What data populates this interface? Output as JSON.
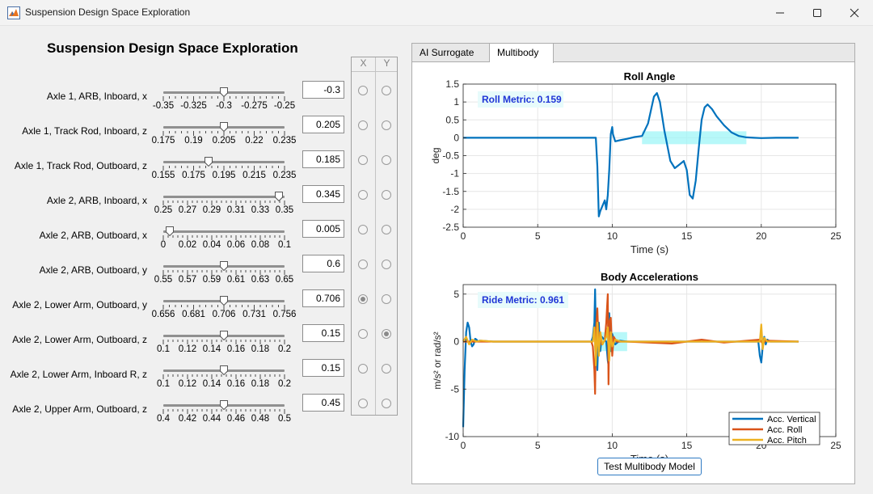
{
  "window": {
    "title": "Suspension Design Space Exploration"
  },
  "main_title": "Suspension Design Space Exploration",
  "axis_headers": {
    "x": "X",
    "y": "Y"
  },
  "parameters": [
    {
      "label": "Axle 1, ARB, Inboard, x",
      "value": "-0.3",
      "min": -0.35,
      "max": -0.25,
      "position": -0.3,
      "ticks": [
        "-0.35",
        "-0.325",
        "-0.3",
        "-0.275",
        "-0.25"
      ],
      "x_selected": false,
      "y_selected": false
    },
    {
      "label": "Axle 1, Track Rod, Inboard, z",
      "value": "0.205",
      "min": 0.175,
      "max": 0.235,
      "position": 0.205,
      "ticks": [
        "0.175",
        "0.19",
        "0.205",
        "0.22",
        "0.235"
      ],
      "x_selected": false,
      "y_selected": false
    },
    {
      "label": "Axle 1, Track Rod, Outboard, z",
      "value": "0.185",
      "min": 0.155,
      "max": 0.235,
      "position": 0.185,
      "ticks": [
        "0.155",
        "0.175",
        "0.195",
        "0.215",
        "0.235"
      ],
      "x_selected": false,
      "y_selected": false
    },
    {
      "label": "Axle 2, ARB, Inboard, x",
      "value": "0.345",
      "min": 0.25,
      "max": 0.35,
      "position": 0.345,
      "ticks": [
        "0.25",
        "0.27",
        "0.29",
        "0.31",
        "0.33",
        "0.35"
      ],
      "x_selected": false,
      "y_selected": false
    },
    {
      "label": "Axle 2, ARB, Outboard, x",
      "value": "0.005",
      "min": 0,
      "max": 0.1,
      "position": 0.005,
      "ticks": [
        "0",
        "0.02",
        "0.04",
        "0.06",
        "0.08",
        "0.1"
      ],
      "x_selected": false,
      "y_selected": false
    },
    {
      "label": "Axle 2, ARB, Outboard, y",
      "value": "0.6",
      "min": 0.55,
      "max": 0.65,
      "position": 0.6,
      "ticks": [
        "0.55",
        "0.57",
        "0.59",
        "0.61",
        "0.63",
        "0.65"
      ],
      "x_selected": false,
      "y_selected": false
    },
    {
      "label": "Axle 2, Lower Arm, Outboard, y",
      "value": "0.706",
      "min": 0.656,
      "max": 0.756,
      "position": 0.706,
      "ticks": [
        "0.656",
        "0.681",
        "0.706",
        "0.731",
        "0.756"
      ],
      "x_selected": true,
      "y_selected": false
    },
    {
      "label": "Axle 2, Lower Arm, Outboard, z",
      "value": "0.15",
      "min": 0.1,
      "max": 0.2,
      "position": 0.15,
      "ticks": [
        "0.1",
        "0.12",
        "0.14",
        "0.16",
        "0.18",
        "0.2"
      ],
      "x_selected": false,
      "y_selected": true
    },
    {
      "label": "Axle 2, Lower Arm, Inboard R, z",
      "value": "0.15",
      "min": 0.1,
      "max": 0.2,
      "position": 0.15,
      "ticks": [
        "0.1",
        "0.12",
        "0.14",
        "0.16",
        "0.18",
        "0.2"
      ],
      "x_selected": false,
      "y_selected": false
    },
    {
      "label": "Axle 2, Upper Arm, Outboard, z",
      "value": "0.45",
      "min": 0.4,
      "max": 0.5,
      "position": 0.45,
      "ticks": [
        "0.4",
        "0.42",
        "0.44",
        "0.46",
        "0.48",
        "0.5"
      ],
      "x_selected": false,
      "y_selected": false
    }
  ],
  "tabs": [
    {
      "label": "AI Surrogate",
      "active": false
    },
    {
      "label": "Multibody",
      "active": true
    }
  ],
  "test_button_label": "Test Multibody Model",
  "chart_data": [
    {
      "type": "line",
      "title": "Roll Angle",
      "xlabel": "Time (s)",
      "ylabel": "deg",
      "xlim": [
        0,
        25
      ],
      "ylim": [
        -2.5,
        1.5
      ],
      "xticks": [
        "0",
        "5",
        "10",
        "15",
        "20",
        "25"
      ],
      "yticks": [
        "-2.5",
        "-2",
        "-1.5",
        "-1",
        "-0.5",
        "0",
        "0.5",
        "1",
        "1.5"
      ],
      "grid": true,
      "annotation": "Roll Metric: 0.159",
      "highlight": {
        "x": [
          12,
          19
        ],
        "y": [
          -0.18,
          0.18
        ],
        "color": "#9ff5f7"
      },
      "series": [
        {
          "color": "#0072bd",
          "x": [
            0,
            8.9,
            9.0,
            9.1,
            9.2,
            9.35,
            9.5,
            9.6,
            9.7,
            9.8,
            9.9,
            10.0,
            10.05,
            10.2,
            10.5,
            11.0,
            11.5,
            12.0,
            12.4,
            12.8,
            13.0,
            13.2,
            13.5,
            13.9,
            14.2,
            14.5,
            14.8,
            15.0,
            15.2,
            15.4,
            15.6,
            15.8,
            16.0,
            16.2,
            16.4,
            16.7,
            17.0,
            17.5,
            18.0,
            18.5,
            19.0,
            19.5,
            20.0,
            21.0,
            22.5
          ],
          "y": [
            0,
            0,
            -0.8,
            -2.2,
            -2.05,
            -1.9,
            -1.75,
            -2.0,
            -1.6,
            -0.9,
            0.1,
            0.3,
            0.1,
            -0.1,
            -0.07,
            -0.03,
            0.02,
            0.05,
            0.4,
            1.15,
            1.25,
            1.0,
            0.2,
            -0.65,
            -0.85,
            -0.75,
            -0.65,
            -0.9,
            -1.6,
            -1.7,
            -1.2,
            -0.3,
            0.5,
            0.85,
            0.93,
            0.8,
            0.6,
            0.35,
            0.15,
            0.05,
            0.01,
            0,
            -0.01,
            0,
            0
          ]
        }
      ]
    },
    {
      "type": "line",
      "title": "Body Accelerations",
      "xlabel": "Time (s)",
      "ylabel": "m/s² or rad/s²",
      "xlim": [
        0,
        25
      ],
      "ylim": [
        -10,
        6
      ],
      "xticks": [
        "0",
        "5",
        "10",
        "15",
        "20",
        "25"
      ],
      "yticks": [
        "-10",
        "-5",
        "0",
        "5"
      ],
      "grid": true,
      "annotation": "Ride Metric: 0.961",
      "highlight": {
        "x": [
          8.8,
          11
        ],
        "y": [
          -1,
          1
        ],
        "color": "#9ff5f7"
      },
      "legend": "bottom-right",
      "series": [
        {
          "name": "Acc. Vertical",
          "color": "#0072bd",
          "x": [
            0,
            0.1,
            0.2,
            0.3,
            0.4,
            0.5,
            0.6,
            0.7,
            0.8,
            0.9,
            1.0,
            1.1,
            2,
            8.6,
            8.7,
            8.8,
            8.85,
            8.9,
            9.0,
            9.1,
            9.2,
            9.3,
            9.6,
            9.7,
            9.75,
            9.8,
            9.9,
            10.0,
            10.2,
            10.5,
            11,
            19.8,
            19.9,
            20.0,
            20.1,
            20.2,
            20.3,
            20.4,
            20.6,
            21,
            22.5
          ],
          "y": [
            -9,
            -3,
            1,
            2,
            1.5,
            0,
            -0.5,
            -0.3,
            0.3,
            0.2,
            0,
            0.1,
            0,
            0,
            0.5,
            2,
            5.5,
            1,
            -3,
            2,
            -1,
            0.5,
            0,
            -2,
            -2.5,
            3,
            -1,
            0.8,
            -0.3,
            0.1,
            0,
            0,
            -1.5,
            -2.2,
            -0.5,
            0.5,
            -0.3,
            0.2,
            0,
            0,
            0
          ]
        },
        {
          "name": "Acc. Roll",
          "color": "#d95319",
          "x": [
            0,
            8.6,
            8.7,
            8.8,
            8.85,
            8.9,
            9.0,
            9.1,
            9.2,
            9.3,
            9.5,
            9.6,
            9.7,
            9.75,
            9.8,
            9.9,
            10.0,
            10.1,
            10.3,
            11,
            14,
            16,
            17.5,
            19.9,
            20.1,
            20.3,
            22.5
          ],
          "y": [
            0,
            0,
            -0.5,
            -3,
            -5.5,
            1,
            3.5,
            -1,
            1,
            -0.3,
            0.1,
            2,
            5,
            -4.5,
            2,
            2.5,
            -1.5,
            0.5,
            0,
            0,
            -0.2,
            0.2,
            -0.1,
            0.2,
            -0.2,
            0.1,
            0
          ]
        },
        {
          "name": "Acc. Pitch",
          "color": "#edb120",
          "x": [
            0,
            0.2,
            0.4,
            0.6,
            0.9,
            1.2,
            2,
            8.7,
            8.8,
            8.9,
            9.0,
            9.1,
            9.2,
            9.35,
            9.6,
            9.7,
            9.8,
            9.9,
            10.0,
            10.2,
            10.6,
            11,
            19.9,
            20.0,
            20.1,
            20.2,
            20.4,
            22.5
          ],
          "y": [
            0,
            0.5,
            -0.3,
            0.2,
            0,
            0.1,
            0,
            0,
            1.5,
            -2.5,
            2,
            -1.5,
            1,
            -0.3,
            0.5,
            1.5,
            -2,
            1,
            -0.5,
            0.2,
            0,
            0,
            0,
            1.8,
            -0.8,
            0.4,
            0,
            0
          ]
        }
      ]
    }
  ]
}
